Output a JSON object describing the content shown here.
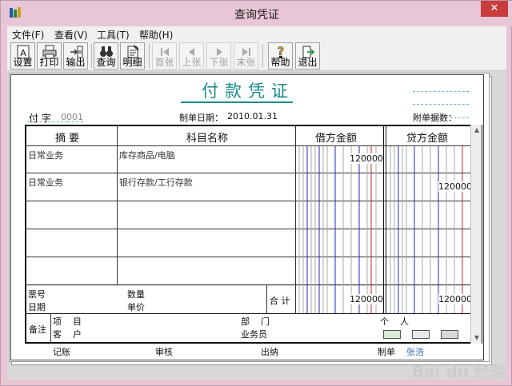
{
  "window": {
    "title": "查询凭证",
    "close_label": "✕"
  },
  "menu": [
    "文件(F)",
    "查看(V)",
    "工具(T)",
    "帮助(H)"
  ],
  "toolbar": {
    "buttons": [
      {
        "label": "设置",
        "icon": "settings-icon",
        "enabled": true
      },
      {
        "label": "打印",
        "icon": "print-icon",
        "enabled": true
      },
      {
        "label": "输出",
        "icon": "export-icon",
        "enabled": true
      },
      {
        "label": "查询",
        "icon": "binoculars-icon",
        "enabled": true
      },
      {
        "label": "明细",
        "icon": "detail-icon",
        "enabled": true
      },
      {
        "label": "首张",
        "icon": "first-icon",
        "enabled": false
      },
      {
        "label": "上张",
        "icon": "prev-icon",
        "enabled": false
      },
      {
        "label": "下张",
        "icon": "next-icon",
        "enabled": false
      },
      {
        "label": "末张",
        "icon": "last-icon",
        "enabled": false
      },
      {
        "label": "帮助",
        "icon": "help-icon",
        "enabled": true
      },
      {
        "label": "退出",
        "icon": "exit-icon",
        "enabled": true
      }
    ]
  },
  "voucher": {
    "title": "付款凭证",
    "type_label": "付 字",
    "number": "0001",
    "date_label": "制单日期：",
    "date": "2010.01.31",
    "attachments_label": "附单据数：",
    "columns": {
      "summary": "摘 要",
      "account": "科目名称",
      "debit": "借方金额",
      "credit": "贷方金额"
    },
    "rows": [
      {
        "summary": "日常业务",
        "account": "库存商品/电脑",
        "debit": "120000",
        "credit": ""
      },
      {
        "summary": "日常业务",
        "account": "银行存款/工行存款",
        "debit": "",
        "credit": "120000"
      },
      {
        "summary": "",
        "account": "",
        "debit": "",
        "credit": ""
      },
      {
        "summary": "",
        "account": "",
        "debit": "",
        "credit": ""
      },
      {
        "summary": "",
        "account": "",
        "debit": "",
        "credit": ""
      }
    ],
    "bill_no_label": "票号",
    "bill_date_label": "日期",
    "qty_label": "数量",
    "price_label": "单价",
    "total_label": "合 计",
    "total_debit": "120000",
    "total_credit": "120000",
    "remark_label": "备注",
    "project_label": "项    目",
    "customer_label": "客    户",
    "dept_label": "部    门",
    "person_label": "个    人",
    "salesman_label": "业务员",
    "footer": {
      "post": "记账",
      "audit": "审核",
      "cashier": "出纳",
      "maker_label": "制单",
      "maker": "张浩"
    }
  },
  "watermark": "Bai du 经验"
}
